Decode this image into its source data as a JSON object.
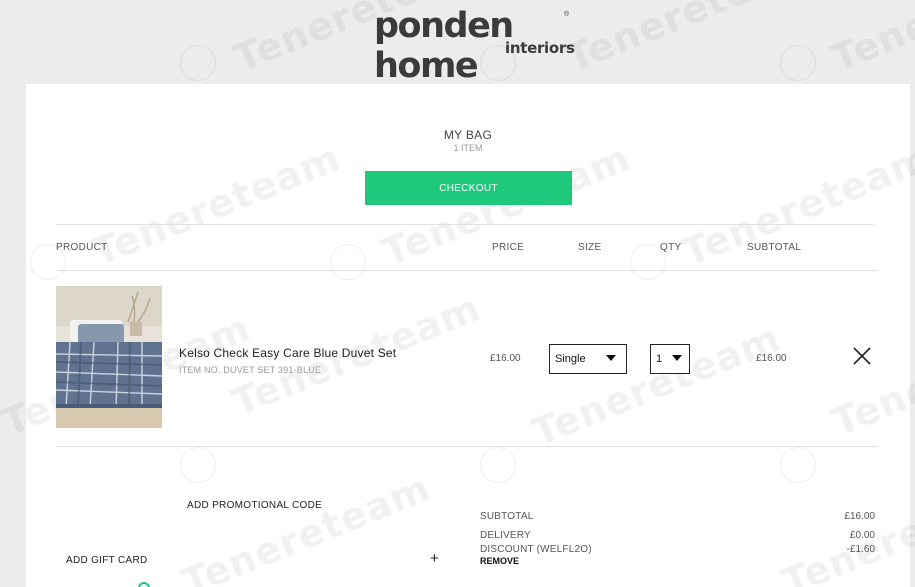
{
  "brand": {
    "name": "ponden home",
    "subname": "interiors",
    "reg": "®"
  },
  "watermark": "Tenereteam",
  "bag": {
    "title": "MY BAG",
    "count": "1 ITEM",
    "checkout_label": "CHECKOUT"
  },
  "table": {
    "headers": {
      "product": "PRODUCT",
      "price": "PRICE",
      "size": "SIZE",
      "qty": "QTY",
      "subtotal": "SUBTOTAL"
    }
  },
  "item": {
    "name": "Kelso Check Easy Care Blue Duvet Set",
    "item_no": "ITEM NO. DUVET SET 391-BLUE",
    "price": "£16.00",
    "size": "Single",
    "qty": "1",
    "subtotal": "£16.00",
    "image_icon": "duvet-product-photo"
  },
  "promo": {
    "label": "ADD PROMOTIONAL CODE"
  },
  "gift": {
    "label": "ADD GIFT CARD",
    "plus": "+"
  },
  "summary": {
    "subtotal_label": "SUBTOTAL",
    "subtotal_value": "£16.00",
    "delivery_label": "DELIVERY",
    "delivery_value": "£0.00",
    "discount_label": "DISCOUNT (WELFL2O)",
    "discount_value": "-£1.60",
    "remove_label": "REMOVE"
  },
  "colors": {
    "accent": "#1ec97b",
    "background": "#ececec",
    "panel": "#ffffff"
  }
}
